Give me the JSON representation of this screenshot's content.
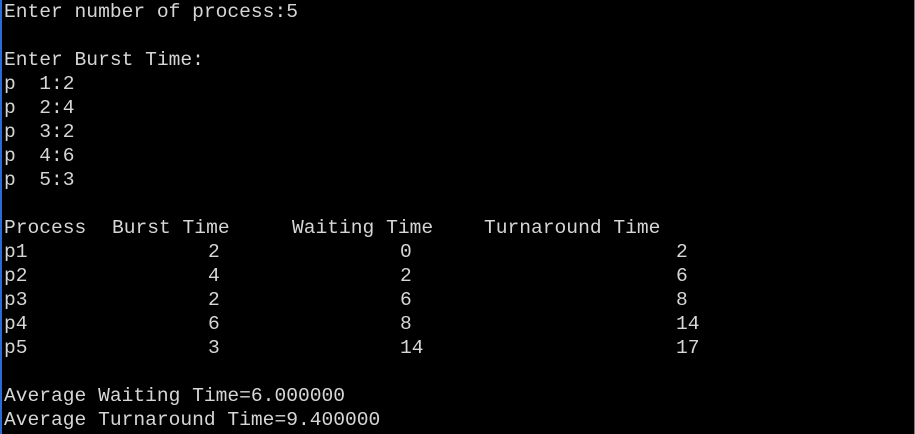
{
  "console": {
    "prompt_count": "Enter number of process:5",
    "prompt_burst": "Enter Burst Time:",
    "burst_inputs": [
      "p  1:2",
      "p  2:4",
      "p  3:2",
      "p  4:6",
      "p  5:3"
    ],
    "table": {
      "headers": {
        "process": "Process",
        "burst": "Burst Time",
        "waiting": "Waiting Time",
        "turnaround": "Turnaround Time"
      },
      "rows": [
        {
          "process": "p1",
          "burst": "2",
          "waiting": "0",
          "turnaround": "2"
        },
        {
          "process": "p2",
          "burst": "4",
          "waiting": "2",
          "turnaround": "6"
        },
        {
          "process": "p3",
          "burst": "2",
          "waiting": "6",
          "turnaround": "8"
        },
        {
          "process": "p4",
          "burst": "6",
          "waiting": "8",
          "turnaround": "14"
        },
        {
          "process": "p5",
          "burst": "3",
          "waiting": "14",
          "turnaround": "17"
        }
      ]
    },
    "avg_waiting": "Average Waiting Time=6.000000",
    "avg_turnaround": "Average Turnaround Time=9.400000"
  },
  "colors": {
    "background": "#000000",
    "text": "#d6d6d6",
    "accent_border": "#2b6cd4"
  }
}
